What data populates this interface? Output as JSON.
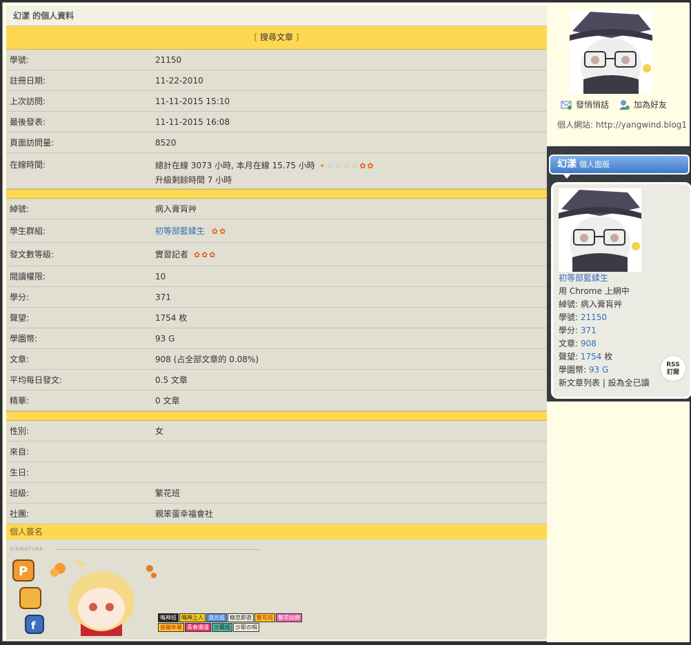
{
  "profile": {
    "title": "幻漾 的個人資料",
    "search_label": "搜尋文章",
    "rows1": [
      {
        "label": "學號:",
        "value": "21150"
      },
      {
        "label": "註冊日期:",
        "value": "11-22-2010"
      },
      {
        "label": "上次訪問:",
        "value": "11-11-2015 15:10"
      },
      {
        "label": "最後發表:",
        "value": "11-11-2015 16:08"
      },
      {
        "label": "頁面訪問量:",
        "value": "8520"
      }
    ],
    "online": {
      "label": "在線時間:",
      "line1": "總計在線 3073 小時, 本月在線 15.75 小時",
      "line2": "升級剩餘時間 7 小時"
    },
    "nickname": {
      "label": "綽號:",
      "value": "病入膏肓艸"
    },
    "group": {
      "label": "學生群組:",
      "value": "初等部藍鍒生"
    },
    "post_level": {
      "label": "發文數等級:",
      "value": "實習記者"
    },
    "rows2": [
      {
        "label": "閱讀權限:",
        "value": "10"
      },
      {
        "label": "學分:",
        "value": "371"
      },
      {
        "label": "聲望:",
        "value": "1754 枚"
      },
      {
        "label": "學園幣:",
        "value": "93 G"
      },
      {
        "label": "文章:",
        "value": "908 (占全部文章的 0.08%)"
      },
      {
        "label": "平均每日發文:",
        "value": "0.5 文章"
      },
      {
        "label": "精華:",
        "value": "0 文章"
      }
    ],
    "rows3": [
      {
        "label": "性別:",
        "value": "女"
      },
      {
        "label": "來自:",
        "value": ""
      },
      {
        "label": "生日:",
        "value": ""
      },
      {
        "label": "班級:",
        "value": "繁花班"
      },
      {
        "label": "社團:",
        "value": "親笨蛋幸福會社"
      }
    ],
    "signature_header": "個人簽名",
    "signature_label": "SIGNATURE:",
    "badges_row1": [
      "鳴神班",
      "鳴神上人",
      "流光班",
      "倏忽即逝",
      "繁花班",
      "繁花似錦"
    ],
    "badges_row2": [
      "昔顯年華",
      "青春爛漫",
      "沙葉班",
      "沙耶の唄"
    ]
  },
  "sidebar": {
    "send_message": "發悄悄話",
    "add_friend": "加為好友",
    "website_label": "個人網站:",
    "website_url": "http://yangwind.blog1",
    "board_name": "幻漾",
    "board_sub": "個人面版",
    "group": "初等部藍鍒生",
    "browser": "用 Chrome 上網中",
    "nick_label": "綽號: ",
    "nick": "病入膏肓艸",
    "id_label": "學號: ",
    "id": "21150",
    "credit_label": "學分: ",
    "credit": "371",
    "posts_label": "文章: ",
    "posts": "908",
    "rep_label": "聲望: ",
    "rep": "1754",
    "rep_unit": " 枚",
    "coins_label": "學園幣: ",
    "coins": "93 G",
    "footer_links": "新文章列表 | 設為全已讀",
    "rss": "RSS\n訂閱"
  }
}
